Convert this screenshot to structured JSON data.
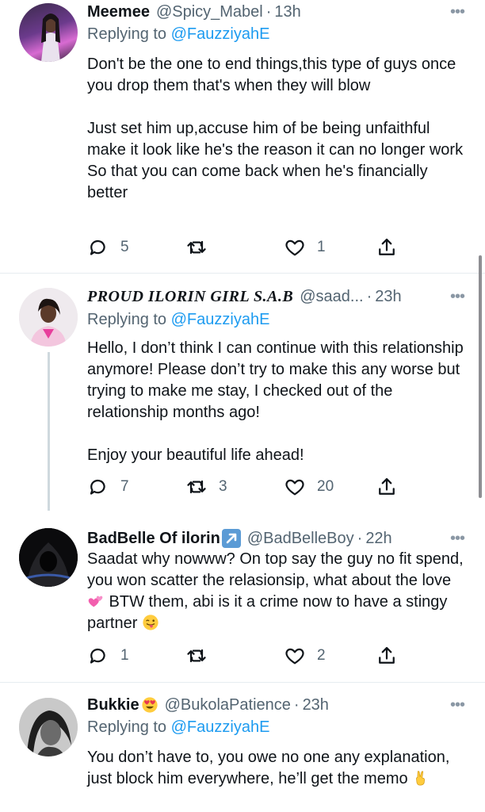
{
  "tweets": [
    {
      "name": "Meemee",
      "handle": "@Spicy_Mabel",
      "time": "13h",
      "replying_label": "Replying to ",
      "replying_to": "@FauzziyahE",
      "body": "Don't be the one to end things,this type of guys once you drop them that's when they will blow\n\nJust set him up,accuse him of be being unfaithful make it look like he's the reason it can no longer work\nSo that you can come back when he's financially better",
      "replies": "5",
      "retweets": "",
      "likes": "1"
    },
    {
      "name": "PROUD ILORIN GIRL S.A.B",
      "handle": "@saad...",
      "time": "23h",
      "replying_label": "Replying to ",
      "replying_to": "@FauzziyahE",
      "body": "Hello, I don’t think I can continue with this relationship anymore! Please don’t try to make this any worse but trying to make me stay, I checked out of the relationship months ago!\n\nEnjoy your beautiful life ahead!",
      "replies": "7",
      "retweets": "3",
      "likes": "20"
    },
    {
      "name": "BadBelle Of ilorin",
      "handle": "@BadBelleBoy",
      "time": "22h",
      "body_part1": "Saadat why nowww? On top say the guy no fit spend, you won scatter the relasionsip, what about the love",
      "body_part2": " BTW them, abi is it a crime now to have a stingy partner",
      "replies": "1",
      "retweets": "",
      "likes": "2"
    },
    {
      "name": "Bukkie",
      "handle": "@BukolaPatience",
      "time": "23h",
      "replying_label": "Replying to ",
      "replying_to": "@FauzziyahE",
      "body": "You don’t have to, you owe no one any explanation, just block him everywhere, he’ll get the memo"
    }
  ],
  "ui": {
    "dot": "·",
    "more": "•••"
  },
  "colors": {
    "link": "#1d9bf0",
    "muted": "#536471",
    "text": "#0f1419",
    "separator": "#e6ecf0",
    "thread_line": "#cfd9de"
  },
  "icons": [
    "reply-icon",
    "retweet-icon",
    "like-icon",
    "share-icon",
    "more-icon",
    "hearts-emoji",
    "winking-tongue-emoji",
    "victory-hand-emoji",
    "heart-eyes-emoji",
    "arrow-badge-emoji"
  ]
}
